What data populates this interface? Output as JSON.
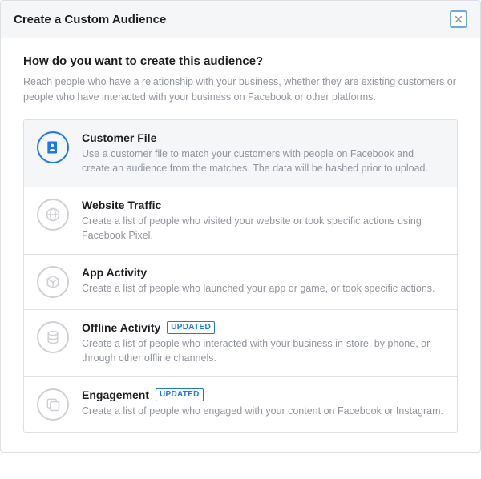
{
  "header": {
    "title": "Create a Custom Audience"
  },
  "body": {
    "question": "How do you want to create this audience?",
    "subtext": "Reach people who have a relationship with your business, whether they are existing customers or people who have interacted with your business on Facebook or other platforms."
  },
  "badge_text": "UPDATED",
  "options": [
    {
      "title": "Customer File",
      "desc": "Use a customer file to match your customers with people on Facebook and create an audience from the matches. The data will be hashed prior to upload.",
      "selected": true,
      "badge": false
    },
    {
      "title": "Website Traffic",
      "desc": "Create a list of people who visited your website or took specific actions using Facebook Pixel.",
      "selected": false,
      "badge": false
    },
    {
      "title": "App Activity",
      "desc": "Create a list of people who launched your app or game, or took specific actions.",
      "selected": false,
      "badge": false
    },
    {
      "title": "Offline Activity",
      "desc": "Create a list of people who interacted with your business in-store, by phone, or through other offline channels.",
      "selected": false,
      "badge": true
    },
    {
      "title": "Engagement",
      "desc": "Create a list of people who engaged with your content on Facebook or Instagram.",
      "selected": false,
      "badge": true
    }
  ]
}
